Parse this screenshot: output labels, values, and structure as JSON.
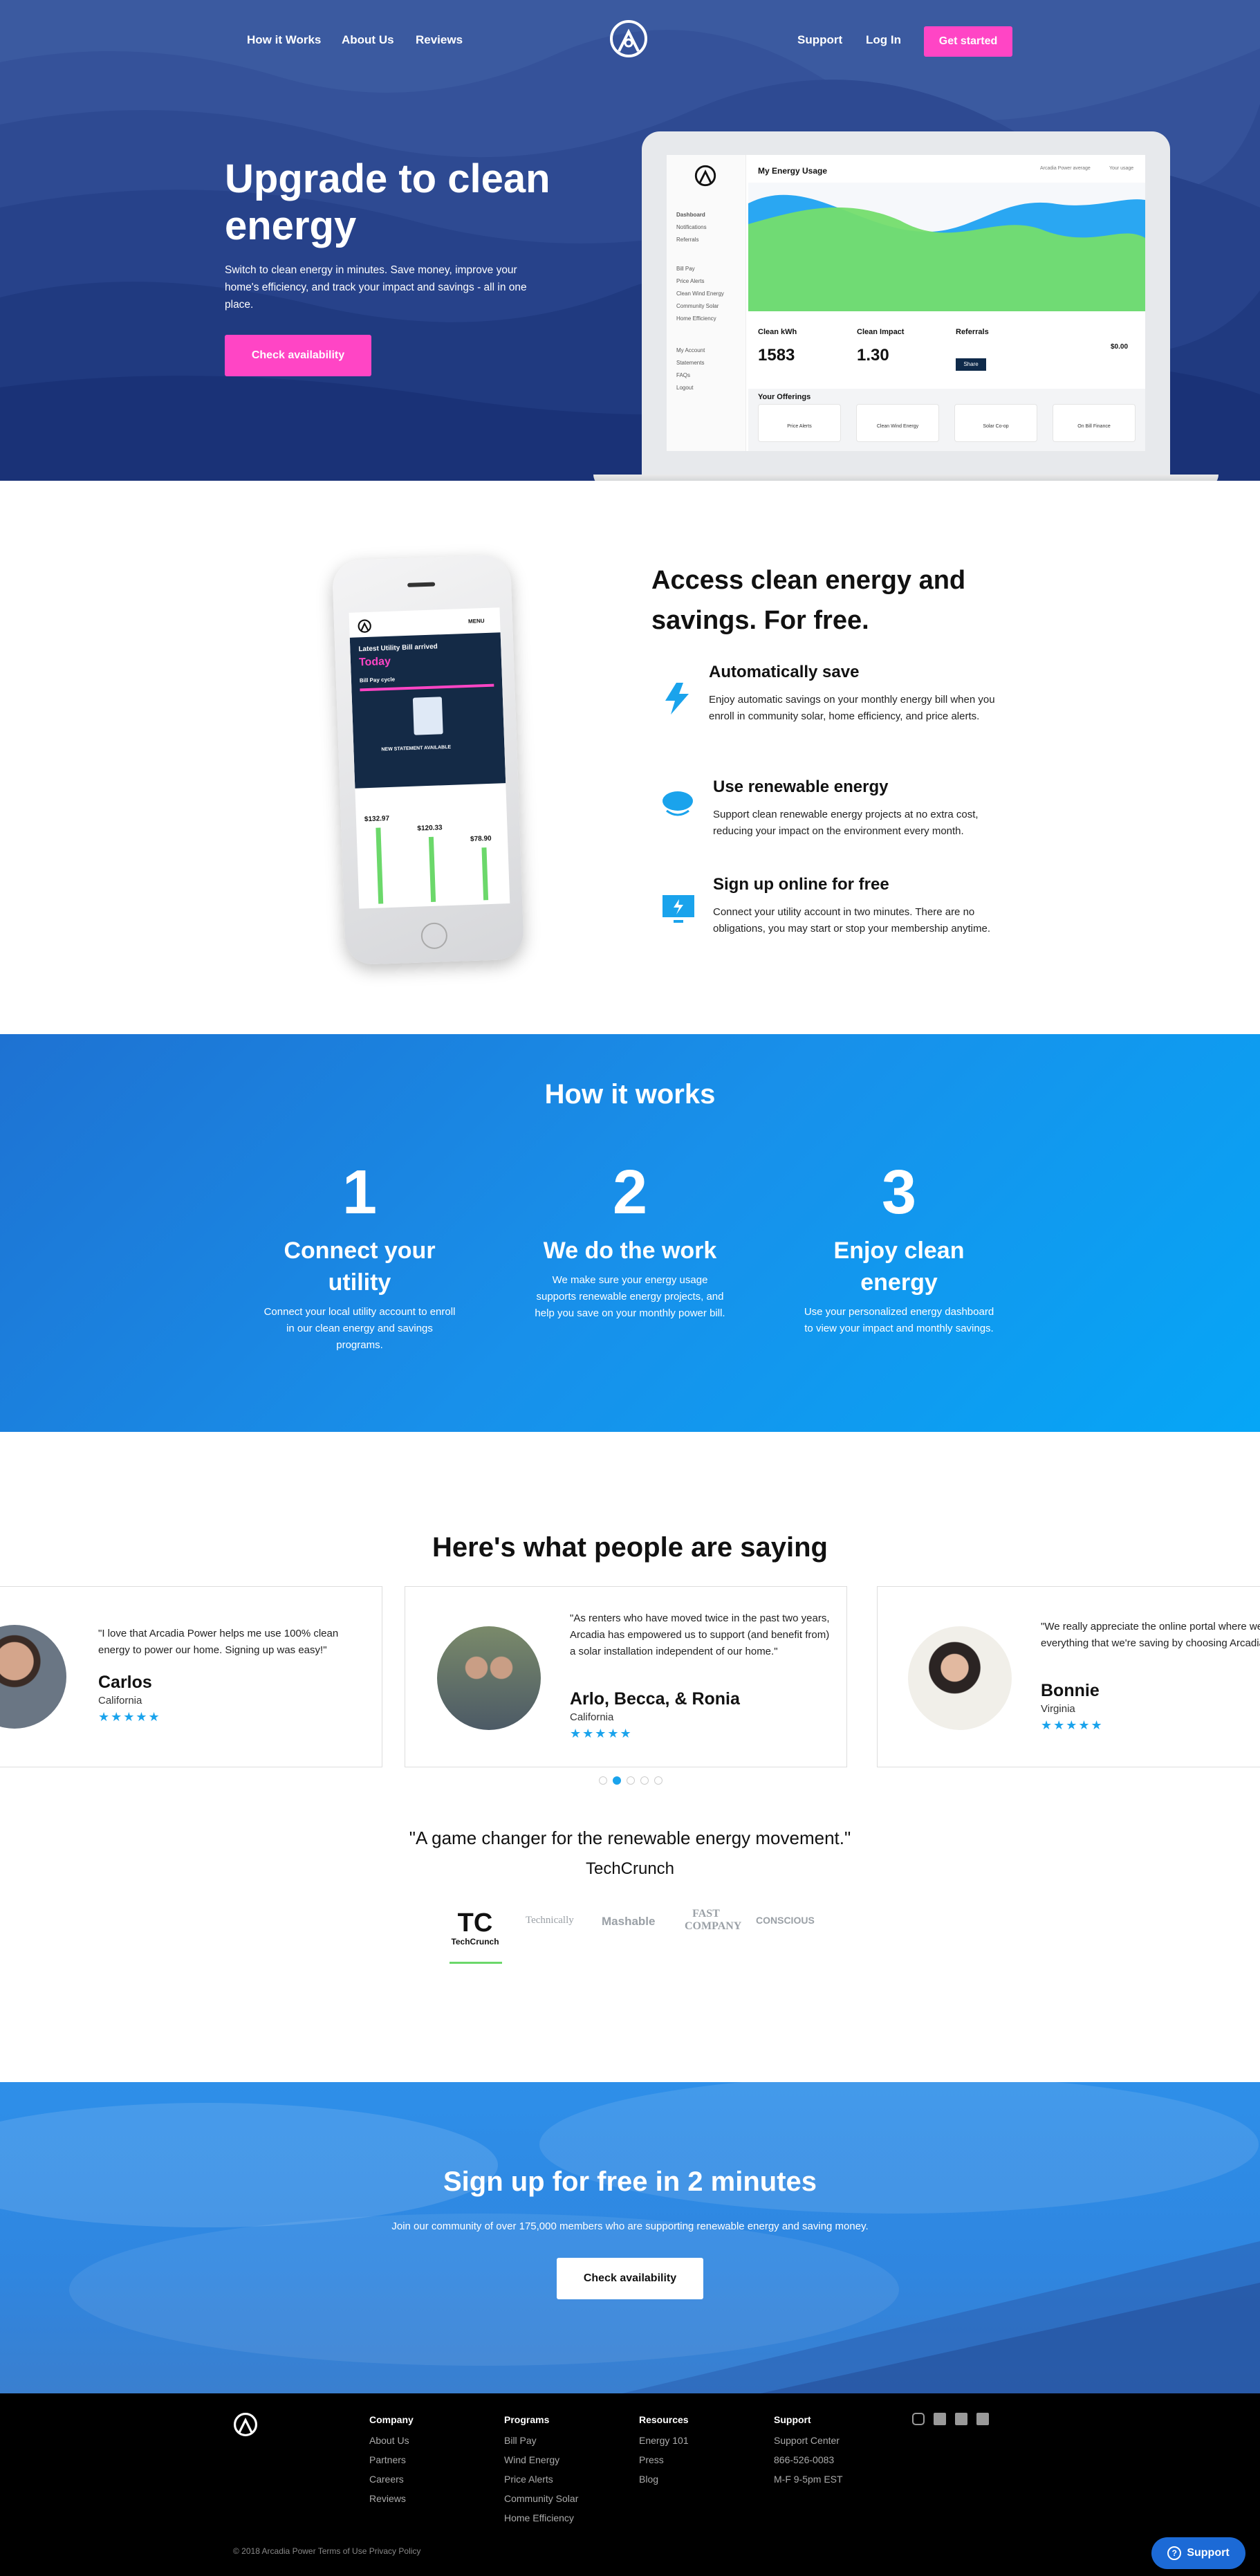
{
  "nav": {
    "links": [
      "How it Works",
      "About Us",
      "Reviews"
    ],
    "support": "Support",
    "login": "Log In",
    "cta": "Get started"
  },
  "hero": {
    "title": "Upgrade to clean energy",
    "subtitle": "Switch to clean energy in minutes. Save money, improve your home's efficiency, and track your impact and savings - all in one place.",
    "button": "Check availability"
  },
  "dashboard": {
    "title": "My Energy Usage",
    "legend": [
      "Arcadia Power average",
      "Your usage"
    ],
    "sidebar": [
      "Dashboard",
      "Notifications",
      "Referrals",
      "Bill Pay",
      "Price Alerts",
      "Clean Wind Energy",
      "Community Solar",
      "Home Efficiency",
      "My Account",
      "Statements",
      "FAQs",
      "Logout"
    ],
    "stats": [
      {
        "label": "Clean kWh",
        "value": "1583"
      },
      {
        "label": "Clean Impact",
        "value": "1.30"
      },
      {
        "label": "Referrals",
        "value": "$0.00"
      }
    ],
    "share": "Share",
    "offerings_title": "Your Offerings",
    "offerings": [
      "Price Alerts",
      "Clean Wind Energy",
      "Solar Co-op",
      "On Bill Finance"
    ]
  },
  "phone": {
    "menu": "MENU",
    "banner": "Latest Utility Bill arrived",
    "today": "Today",
    "bill_pay": "Bill Pay cycle",
    "statement": "NEW STATEMENT AVAILABLE",
    "bars": [
      "$132.97",
      "$120.33",
      "$78.90"
    ]
  },
  "access": {
    "title": "Access clean energy and savings. For free.",
    "features": [
      {
        "title": "Automatically save",
        "text": "Enjoy automatic savings on your monthly energy bill when you enroll in community solar, home efficiency, and price alerts."
      },
      {
        "title": "Use renewable energy",
        "text": "Support clean renewable energy projects at no extra cost, reducing your impact on the environment every month."
      },
      {
        "title": "Sign up online for free",
        "text": "Connect your utility account in two minutes. There are no obligations, you may start or stop your membership anytime."
      }
    ]
  },
  "how": {
    "title": "How it works",
    "steps": [
      {
        "num": "1",
        "title": "Connect your utility",
        "text": "Connect your local utility account to enroll in our clean energy and savings programs."
      },
      {
        "num": "2",
        "title": "We do the work",
        "text": "We make sure your energy usage supports renewable energy projects, and help you save on your monthly power bill."
      },
      {
        "num": "3",
        "title": "Enjoy clean energy",
        "text": "Use your personalized energy dashboard to view your impact and monthly savings."
      }
    ]
  },
  "testimonials": {
    "title": "Here's what people are saying",
    "items": [
      {
        "quote": "\"I love that Arcadia Power helps me use 100% clean energy to power our home. Signing up was easy!\"",
        "name": "Carlos",
        "state": "California",
        "stars": "★★★★★"
      },
      {
        "quote": "\"As renters who have moved twice in the past two years, Arcadia has empowered us to support (and benefit from) a solar installation independent of our home.\"",
        "name": "Arlo, Becca, & Ronia",
        "state": "California",
        "stars": "★★★★★"
      },
      {
        "quote": "\"We really appreciate the online portal where we see everything that we're saving by choosing Arcadia Power.\"",
        "name": "Bonnie",
        "state": "Virginia",
        "stars": "★★★★★"
      }
    ]
  },
  "press": {
    "quote": "\"A game changer for the renewable energy movement.\"",
    "source": "TechCrunch",
    "logos": [
      "TechCrunch",
      "Technically",
      "Mashable",
      "FAST COMPANY",
      "CONSCIOUS"
    ]
  },
  "cta": {
    "title": "Sign up for free in 2 minutes",
    "subtitle": "Join our community of over 175,000 members who are supporting renewable energy and saving money.",
    "button": "Check availability"
  },
  "footer": {
    "columns": [
      {
        "title": "Company",
        "links": [
          "About Us",
          "Partners",
          "Careers",
          "Reviews"
        ]
      },
      {
        "title": "Programs",
        "links": [
          "Bill Pay",
          "Wind Energy",
          "Price Alerts",
          "Community Solar",
          "Home Efficiency"
        ]
      },
      {
        "title": "Resources",
        "links": [
          "Energy 101",
          "Press",
          "Blog"
        ]
      },
      {
        "title": "Support",
        "links": [
          "Support Center",
          "866-526-0083",
          "M-F 9-5pm EST"
        ]
      }
    ],
    "copyright": "© 2018 Arcadia Power Terms of Use Privacy Policy",
    "support_button": "Support"
  },
  "colors": {
    "accent": "#ff45c5",
    "blue": "#1aa3ec",
    "green": "#6bd86a"
  }
}
